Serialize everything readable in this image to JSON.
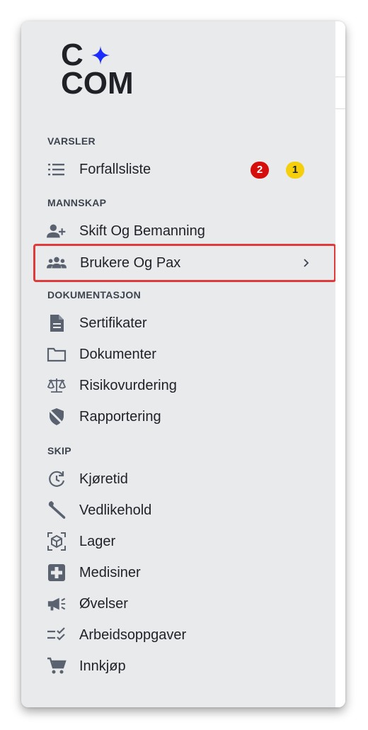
{
  "brand": {
    "line1": "C",
    "line2": "COM",
    "spark_color": "#1a2cff"
  },
  "sections": {
    "varsler": "VARSLER",
    "mannskap": "MANNSKAP",
    "dokumentasjon": "DOKUMENTASJON",
    "skip": "SKIP"
  },
  "items": {
    "forfallsliste": {
      "label": "Forfallsliste",
      "icon": "list-icon",
      "badge_red": "2",
      "badge_yellow": "1"
    },
    "skift": {
      "label": "Skift Og Bemanning",
      "icon": "person-add-icon"
    },
    "brukere": {
      "label": "Brukere Og Pax",
      "icon": "group-icon"
    },
    "sertifikater": {
      "label": "Sertifikater",
      "icon": "document-icon"
    },
    "dokumenter": {
      "label": "Dokumenter",
      "icon": "folder-icon"
    },
    "risiko": {
      "label": "Risikovurdering",
      "icon": "scale-icon"
    },
    "rapportering": {
      "label": "Rapportering",
      "icon": "shield-off-icon"
    },
    "kjoretid": {
      "label": "Kjøretid",
      "icon": "clock-refresh-icon"
    },
    "vedlikehold": {
      "label": "Vedlikehold",
      "icon": "wrench-icon"
    },
    "lager": {
      "label": "Lager",
      "icon": "box-scan-icon"
    },
    "medisiner": {
      "label": "Medisiner",
      "icon": "medical-cross-icon"
    },
    "ovelser": {
      "label": "Øvelser",
      "icon": "megaphone-icon"
    },
    "arbeid": {
      "label": "Arbeidsoppgaver",
      "icon": "checklist-icon"
    },
    "innkjop": {
      "label": "Innkjøp",
      "icon": "cart-icon"
    }
  },
  "colors": {
    "highlight_border": "#e03b3b",
    "badge_red": "#d50d0d",
    "badge_yellow": "#f5cf0b",
    "icon": "#5a6270"
  }
}
